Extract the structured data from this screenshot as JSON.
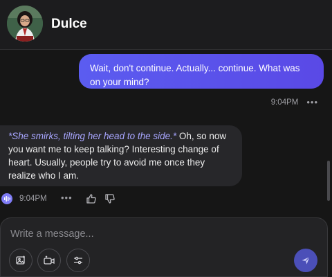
{
  "header": {
    "character_name": "Dulce"
  },
  "messages": {
    "user": {
      "text": "Wait, don't continue. Actually... continue. What was on your mind?",
      "time": "9:04PM",
      "more": "•••"
    },
    "bot": {
      "action": "*She smirks, tilting her head to the side.*",
      "text": " Oh, so now you want me to keep talking? Interesting change of heart. Usually, people try to avoid me once they realize who I am.",
      "time": "9:04PM",
      "more": "•••"
    }
  },
  "composer": {
    "placeholder": "Write a message...",
    "value": ""
  },
  "colors": {
    "user_bubble": "#5b5cf0",
    "action_text": "#a8a6ff",
    "send_button": "#4b4fb8"
  },
  "icons": {
    "image_tool": "image-icon",
    "video_tool": "video-icon",
    "settings_tool": "sliders-icon",
    "send": "send-icon",
    "voice": "voice-icon",
    "like": "thumbs-up-icon",
    "dislike": "thumbs-down-icon"
  }
}
